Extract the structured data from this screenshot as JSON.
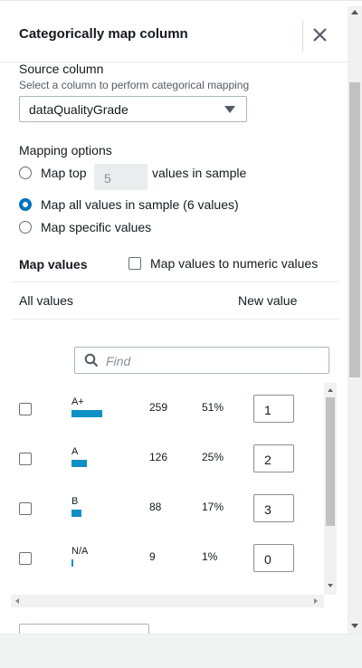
{
  "panel": {
    "title": "Categorically map column",
    "close_icon": "close-icon"
  },
  "source": {
    "label": "Source column",
    "description": "Select a column to perform categorical mapping",
    "selected": "dataQualityGrade"
  },
  "mapping_options": {
    "label": "Mapping options",
    "top_label": "Map top",
    "top_value": "5",
    "top_suffix": "values in sample",
    "all_label": "Map all values in sample (6 values)",
    "specific_label": "Map specific values",
    "selected": "all"
  },
  "map_values": {
    "label": "Map values",
    "numeric_label": "Map values to numeric values",
    "col_all": "All values",
    "col_new": "New value"
  },
  "find": {
    "placeholder": "Find"
  },
  "rows": [
    {
      "category": "A+",
      "count": "259",
      "percent": "51%",
      "new_value": "1",
      "fraction": 0.51
    },
    {
      "category": "A",
      "count": "126",
      "percent": "25%",
      "new_value": "2",
      "fraction": 0.25
    },
    {
      "category": "B",
      "count": "88",
      "percent": "17%",
      "new_value": "3",
      "fraction": 0.17
    },
    {
      "category": "N/A",
      "count": "9",
      "percent": "1%",
      "new_value": "0",
      "fraction": 0.01
    }
  ],
  "colors": {
    "accent": "#0073bb",
    "bar": "#0f90c6"
  }
}
